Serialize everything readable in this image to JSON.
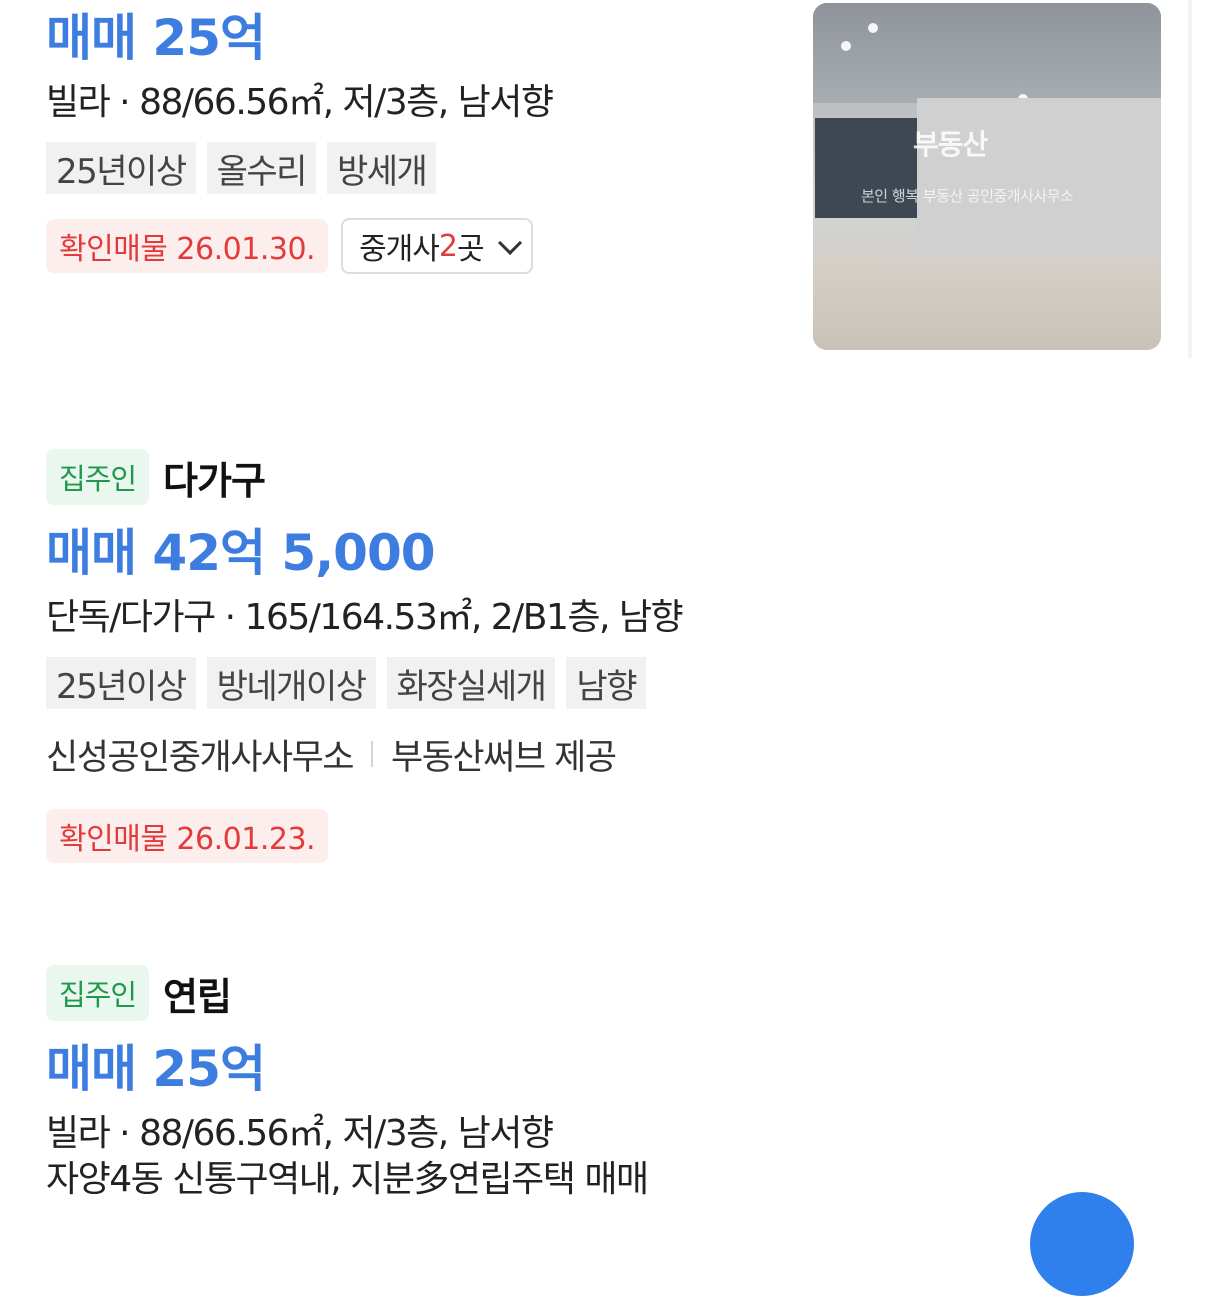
{
  "listings": [
    {
      "price": "매매 25억",
      "info": "빌라 · 88/66.56㎡, 저/3층, 남서향",
      "tags": [
        "25년이상",
        "올수리",
        "방세개"
      ],
      "verified": "확인매물 26.01.30.",
      "agent_button": {
        "prefix": "중개사 ",
        "count": "2",
        "suffix": "곳"
      },
      "thumbnail": {
        "logo": "부동산",
        "logo_sub": "본인 행복 부동산 공인중개사사무소"
      }
    },
    {
      "owner_badge": "집주인",
      "type": "다가구",
      "price": "매매 42억 5,000",
      "info": "단독/다가구 · 165/164.53㎡, 2/B1층, 남향",
      "tags": [
        "25년이상",
        "방네개이상",
        "화장실세개",
        "남향"
      ],
      "agency": "신성공인중개사사무소",
      "provider": "부동산써브 제공",
      "verified": "확인매물 26.01.23."
    },
    {
      "owner_badge": "집주인",
      "type": "연립",
      "price": "매매 25억",
      "info": "빌라 · 88/66.56㎡, 저/3층, 남서향",
      "description": "자양4동 신통구역내, 지분多연립주택 매매"
    }
  ],
  "colors": {
    "price_blue": "#3d7de0",
    "owner_green": "#1f9a4c",
    "verified_red": "#e23b3b"
  }
}
